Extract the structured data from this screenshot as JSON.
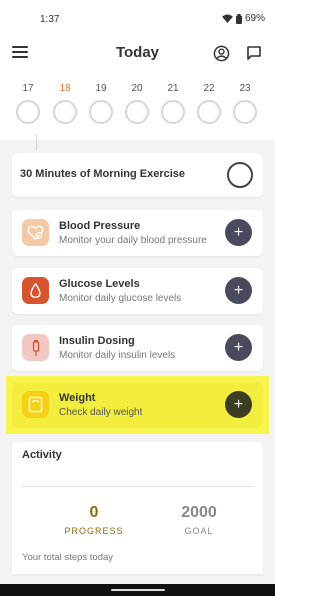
{
  "status_bar": {
    "time": "1:37",
    "battery": "69%",
    "icons": [
      "wifi-icon",
      "battery-icon"
    ]
  },
  "header": {
    "title": "Today",
    "icons": [
      "menu-icon",
      "account-icon",
      "chat-icon"
    ]
  },
  "calendar": {
    "days": [
      "17",
      "18",
      "19",
      "20",
      "21",
      "22",
      "23"
    ],
    "today": "18",
    "today_color": "#e07a2e"
  },
  "exercise": {
    "title": "30 Minutes of Morning Exercise"
  },
  "trackers": [
    {
      "title": "Blood Pressure",
      "subtitle": "Monitor your daily blood pressure",
      "icon": "heart-check-icon",
      "icon_bg": "#f5c9a6"
    },
    {
      "title": "Glucose Levels",
      "subtitle": "Monitor daily glucose levels",
      "icon": "drop-icon",
      "icon_bg": "#d6542e"
    },
    {
      "title": "Insulin Dosing",
      "subtitle": "Monitor daily insulin levels",
      "icon": "syringe-icon",
      "icon_bg": "#f2c8c2"
    },
    {
      "title": "Weight",
      "subtitle": "Check daily weight",
      "icon": "scale-icon",
      "icon_bg": "#f5d017"
    }
  ],
  "activity": {
    "title": "Activity",
    "progress_value": "0",
    "progress_label": "PROGRESS",
    "goal_value": "2000",
    "goal_label": "GOAL",
    "footer": "Your total steps today"
  },
  "colors": {
    "highlight": "#f7f34f",
    "add_button": "#4a4a5e",
    "progress": "#8a6a12"
  }
}
